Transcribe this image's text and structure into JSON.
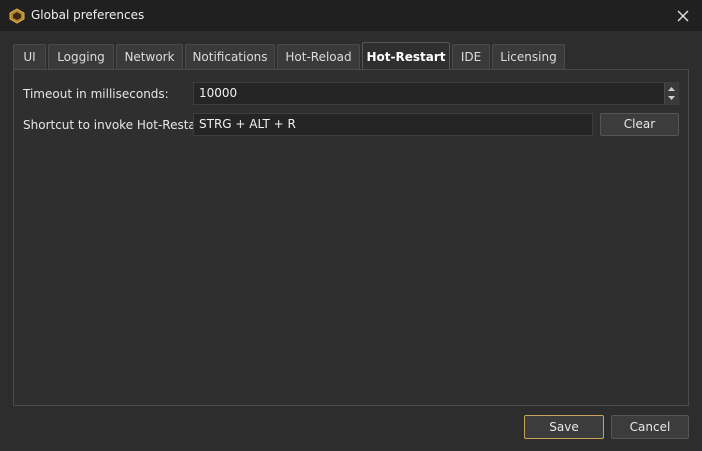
{
  "window": {
    "title": "Global preferences"
  },
  "tabs": [
    {
      "label": "UI"
    },
    {
      "label": "Logging"
    },
    {
      "label": "Network"
    },
    {
      "label": "Notifications"
    },
    {
      "label": "Hot-Reload"
    },
    {
      "label": "Hot-Restart"
    },
    {
      "label": "IDE"
    },
    {
      "label": "Licensing"
    }
  ],
  "active_tab": "Hot-Restart",
  "settings": {
    "timeout_label": "Timeout in milliseconds:",
    "timeout_value": "10000",
    "shortcut_label": "Shortcut to invoke Hot-Restart:",
    "shortcut_value": "STRG + ALT + R",
    "clear_label": "Clear"
  },
  "footer": {
    "save_label": "Save",
    "cancel_label": "Cancel"
  },
  "colors": {
    "accent": "#c8a35a",
    "background": "#2d2d2d",
    "titlebar": "#202020"
  }
}
